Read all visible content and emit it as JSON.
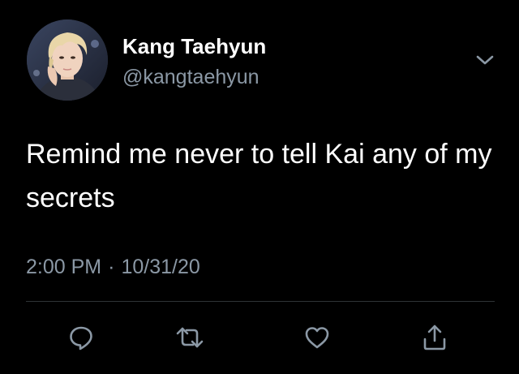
{
  "tweet": {
    "author": {
      "display_name": "Kang Taehyun",
      "handle": "@kangtaehyun"
    },
    "text": "Remind me never to tell Kai any of my secrets",
    "time": "2:00 PM",
    "separator": "·",
    "date": "10/31/20"
  },
  "actions": {
    "icons": [
      "reply-icon",
      "retweet-icon",
      "like-icon",
      "share-icon"
    ]
  },
  "colors": {
    "background": "#000000",
    "text_primary": "#ffffff",
    "text_secondary": "#8b98a5",
    "divider": "#2f3336",
    "icon": "#8b98a5"
  }
}
